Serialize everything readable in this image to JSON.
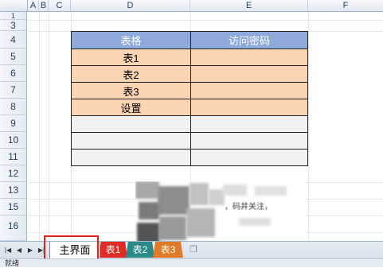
{
  "columns": [
    "A",
    "B",
    "C",
    "D",
    "E",
    "F"
  ],
  "rows": [
    "1",
    "3",
    "4",
    "5",
    "6",
    "7",
    "8",
    "9",
    "10",
    "11",
    "12",
    "13",
    "15",
    "16"
  ],
  "table": {
    "headers": [
      "表格",
      "访问密码"
    ],
    "rows": [
      {
        "name": "表1",
        "password": ""
      },
      {
        "name": "表2",
        "password": ""
      },
      {
        "name": "表3",
        "password": ""
      },
      {
        "name": "设置",
        "password": ""
      },
      {
        "name": "",
        "password": ""
      },
      {
        "name": "",
        "password": ""
      },
      {
        "name": "",
        "password": ""
      }
    ],
    "header_color": "#8eaadb",
    "peach_color": "#fbd4b4",
    "grey_color": "#f2f2f2"
  },
  "image_text": "，码并关注，",
  "tabs": {
    "active": "主界面",
    "others": [
      {
        "label": "表1",
        "color": "#e02a26"
      },
      {
        "label": "表2",
        "color": "#2a8a8a"
      },
      {
        "label": "表3",
        "color": "#e07a26"
      }
    ]
  },
  "nav_icons": [
    "first-sheet-icon",
    "prev-sheet-icon",
    "next-sheet-icon",
    "last-sheet-icon",
    "insert-sheet-icon"
  ],
  "status": "就绪"
}
